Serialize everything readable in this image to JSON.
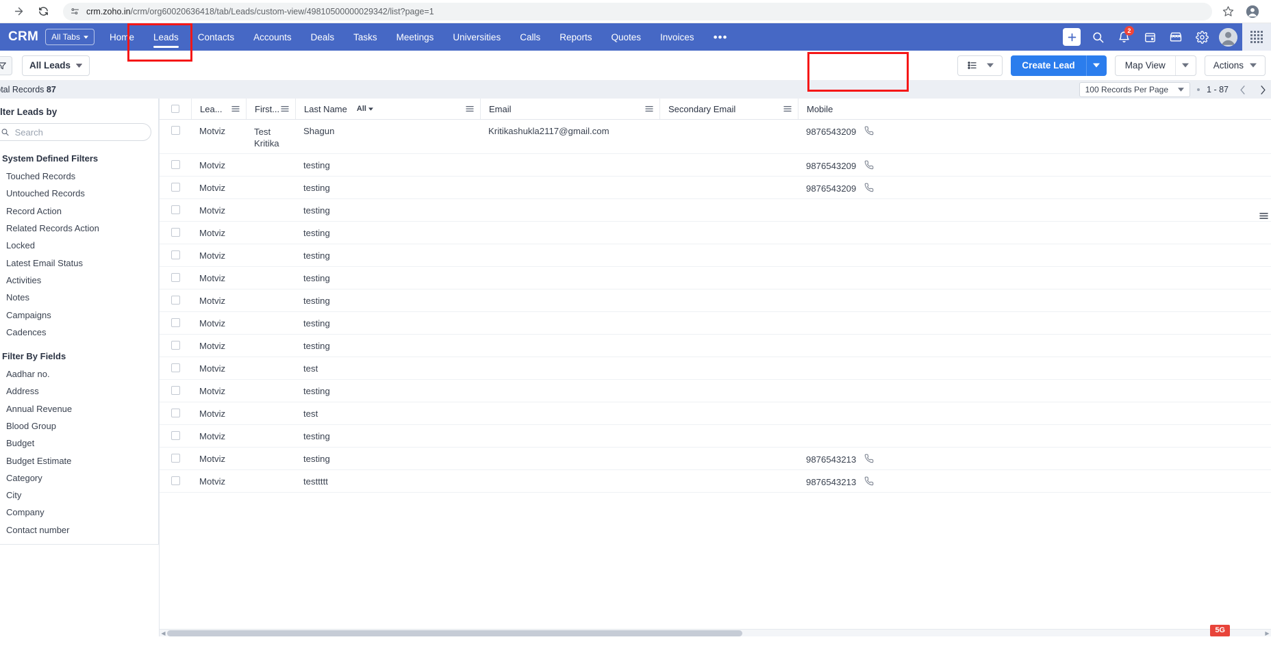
{
  "browser": {
    "url_host": "crm.zoho.in",
    "url_path": "/crm/org60020636418/tab/Leads/custom-view/49810500000029342/list?page=1",
    "forward_icon": "forward-arrow-icon",
    "reload_icon": "reload-icon",
    "site_info_icon": "site-settings-icon",
    "bookmark_icon": "star-icon",
    "profile_icon": "browser-profile-icon"
  },
  "topnav": {
    "logo": "CRM",
    "all_tabs_label": "All Tabs",
    "tabs": [
      {
        "label": "Home",
        "active": false
      },
      {
        "label": "Leads",
        "active": true
      },
      {
        "label": "Contacts",
        "active": false
      },
      {
        "label": "Accounts",
        "active": false
      },
      {
        "label": "Deals",
        "active": false
      },
      {
        "label": "Tasks",
        "active": false
      },
      {
        "label": "Meetings",
        "active": false
      },
      {
        "label": "Universities",
        "active": false
      },
      {
        "label": "Calls",
        "active": false
      },
      {
        "label": "Reports",
        "active": false
      },
      {
        "label": "Quotes",
        "active": false
      },
      {
        "label": "Invoices",
        "active": false
      }
    ],
    "more_label": "•••",
    "icons": {
      "add": "plus-icon",
      "search": "search-icon",
      "notifications": "bell-icon",
      "notification_count": "2",
      "calendar": "calendar-icon",
      "marketplace": "marketplace-icon",
      "settings": "gear-icon",
      "avatar": "user-avatar",
      "app_launcher": "app-grid-icon"
    },
    "accent_color": "#4668c5"
  },
  "toolbar": {
    "filter_icon": "funnel-icon",
    "view_name": "All Leads",
    "list_layout_icon": "list-view-icon",
    "create_label": "Create Lead",
    "create_color": "#2b7ded",
    "map_view_label": "Map View",
    "actions_label": "Actions"
  },
  "subheader": {
    "total_label": "Total Records",
    "total_value": "87",
    "records_per_page": "100 Records Per Page",
    "range": "1 - 87",
    "prev_icon": "chevron-left-icon",
    "next_icon": "chevron-right-icon"
  },
  "sidebar": {
    "title": "Filter Leads by",
    "search_placeholder": "Search",
    "search_value": "",
    "groups": [
      {
        "label": "System Defined Filters",
        "items": [
          "Touched Records",
          "Untouched Records",
          "Record Action",
          "Related Records Action",
          "Locked",
          "Latest Email Status",
          "Activities",
          "Notes",
          "Campaigns",
          "Cadences"
        ]
      },
      {
        "label": "Filter By Fields",
        "items": [
          "Aadhar no.",
          "Address",
          "Annual Revenue",
          "Blood Group",
          "Budget",
          "Budget Estimate",
          "Category",
          "City",
          "Company",
          "Contact number"
        ]
      }
    ]
  },
  "table": {
    "columns": [
      {
        "key": "lead_source",
        "label": "Lea...",
        "menu": true
      },
      {
        "key": "first_name",
        "label": "First...",
        "menu": true
      },
      {
        "key": "last_name",
        "label": "Last Name",
        "filter": "All",
        "menu": true
      },
      {
        "key": "email",
        "label": "Email",
        "menu": true
      },
      {
        "key": "secondary_email",
        "label": "Secondary Email",
        "menu": true
      },
      {
        "key": "mobile",
        "label": "Mobile",
        "menu": false
      }
    ],
    "rows": [
      {
        "lead_source": "Motviz",
        "first_name": "Test Kritika",
        "last_name": "Shagun",
        "email": "Kritikashukla2117@gmail.com",
        "secondary_email": "",
        "mobile": "9876543209",
        "tall": true
      },
      {
        "lead_source": "Motviz",
        "first_name": "",
        "last_name": "testing",
        "email": "",
        "secondary_email": "",
        "mobile": "9876543209"
      },
      {
        "lead_source": "Motviz",
        "first_name": "",
        "last_name": "testing",
        "email": "",
        "secondary_email": "",
        "mobile": "9876543209"
      },
      {
        "lead_source": "Motviz",
        "first_name": "",
        "last_name": "testing",
        "email": "",
        "secondary_email": "",
        "mobile": ""
      },
      {
        "lead_source": "Motviz",
        "first_name": "",
        "last_name": "testing",
        "email": "",
        "secondary_email": "",
        "mobile": ""
      },
      {
        "lead_source": "Motviz",
        "first_name": "",
        "last_name": "testing",
        "email": "",
        "secondary_email": "",
        "mobile": ""
      },
      {
        "lead_source": "Motviz",
        "first_name": "",
        "last_name": "testing",
        "email": "",
        "secondary_email": "",
        "mobile": ""
      },
      {
        "lead_source": "Motviz",
        "first_name": "",
        "last_name": "testing",
        "email": "",
        "secondary_email": "",
        "mobile": ""
      },
      {
        "lead_source": "Motviz",
        "first_name": "",
        "last_name": "testing",
        "email": "",
        "secondary_email": "",
        "mobile": ""
      },
      {
        "lead_source": "Motviz",
        "first_name": "",
        "last_name": "testing",
        "email": "",
        "secondary_email": "",
        "mobile": ""
      },
      {
        "lead_source": "Motviz",
        "first_name": "",
        "last_name": "test",
        "email": "",
        "secondary_email": "",
        "mobile": ""
      },
      {
        "lead_source": "Motviz",
        "first_name": "",
        "last_name": "testing",
        "email": "",
        "secondary_email": "",
        "mobile": ""
      },
      {
        "lead_source": "Motviz",
        "first_name": "",
        "last_name": "test",
        "email": "",
        "secondary_email": "",
        "mobile": ""
      },
      {
        "lead_source": "Motviz",
        "first_name": "",
        "last_name": "testing",
        "email": "",
        "secondary_email": "",
        "mobile": ""
      },
      {
        "lead_source": "Motviz",
        "first_name": "",
        "last_name": "testing",
        "email": "",
        "secondary_email": "",
        "mobile": "9876543213"
      },
      {
        "lead_source": "Motviz",
        "first_name": "",
        "last_name": "testtttt",
        "email": "",
        "secondary_email": "",
        "mobile": "9876543213"
      }
    ],
    "phone_icon": "phone-icon",
    "column_menu_icon": "column-menu-icon"
  },
  "annotations": {
    "highlight_color": "#f51717",
    "badge_text": "5G"
  }
}
